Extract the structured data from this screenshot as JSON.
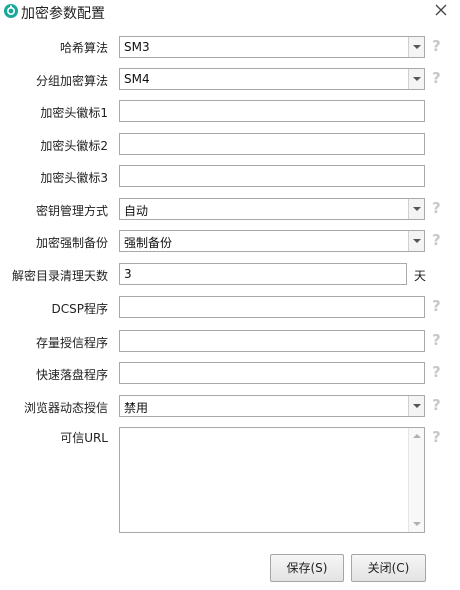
{
  "window": {
    "title": "加密参数配置"
  },
  "form": {
    "hash_label": "哈希算法",
    "hash_value": "SM3",
    "block_label": "分组加密算法",
    "block_value": "SM4",
    "header1_label": "加密头徽标1",
    "header1_value": "",
    "header2_label": "加密头徽标2",
    "header2_value": "",
    "header3_label": "加密头徽标3",
    "header3_value": "",
    "keymgmt_label": "密钥管理方式",
    "keymgmt_value": "自动",
    "backup_label": "加密强制备份",
    "backup_value": "强制备份",
    "cleanup_label": "解密目录清理天数",
    "cleanup_value": "3",
    "cleanup_unit": "天",
    "dcsp_label": "DCSP程序",
    "dcsp_value": "",
    "storage_label": "存量授信程序",
    "storage_value": "",
    "fastdrop_label": "快速落盘程序",
    "fastdrop_value": "",
    "browser_label": "浏览器动态授信",
    "browser_value": "禁用",
    "url_label": "可信URL",
    "url_value": ""
  },
  "help_glyph": "?",
  "buttons": {
    "save": "保存(S)",
    "close": "关闭(C)"
  },
  "colors": {
    "icon_teal": "#1aa89a",
    "help_gray": "#c8c8c8"
  }
}
